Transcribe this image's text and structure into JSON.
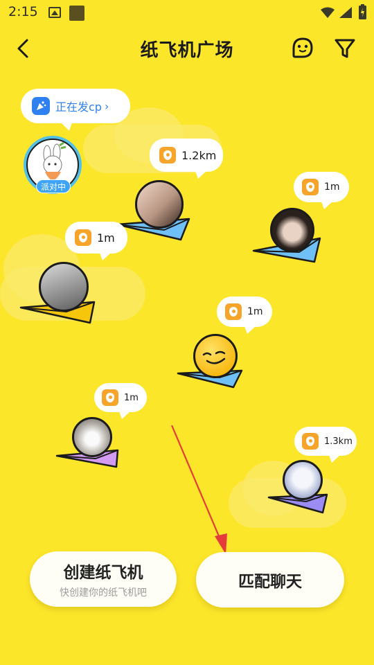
{
  "status_bar": {
    "time": "2:15"
  },
  "header": {
    "title": "纸飞机广场"
  },
  "party": {
    "bubble_text": "正在发cp",
    "chevron": "›",
    "badge": "派对中"
  },
  "planes": [
    {
      "distance": "1.2km"
    },
    {
      "distance": "1m"
    },
    {
      "distance": "1m"
    },
    {
      "distance": "1m"
    },
    {
      "distance": "1m"
    },
    {
      "distance": "1.3km"
    }
  ],
  "actions": {
    "create_label": "创建纸飞机",
    "create_sub": "快创建你的纸飞机吧",
    "match_label": "匹配聊天"
  },
  "colors": {
    "background": "#FCE62A",
    "accent_blue": "#2F80F0",
    "pin_orange": "#F7A52A",
    "plane_blue": "#6FC0F6",
    "plane_yellow": "#F5C60A",
    "plane_purple": "#D49BF2",
    "plane_indigo": "#9A8CF3",
    "arrow_red": "#E63B3B"
  }
}
